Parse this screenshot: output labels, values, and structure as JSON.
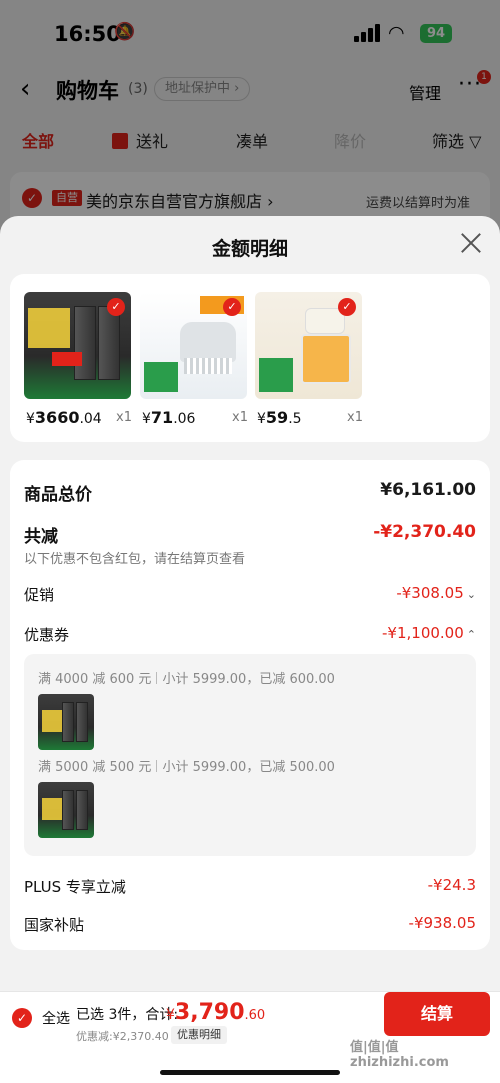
{
  "status_bar": {
    "time": "16:50",
    "battery": "94"
  },
  "nav": {
    "title": "购物车",
    "count": "(3)",
    "address_protect": "地址保护中 ›",
    "manage": "管理",
    "more": "···",
    "badge": "1"
  },
  "filters": {
    "all": "全部",
    "gift": "送礼",
    "combo": "凑单",
    "price_drop": "降价",
    "filter": "筛选"
  },
  "store": {
    "tag": "自营",
    "name": "美的京东自营官方旗舰店 ›",
    "note": "运费以结算时为准"
  },
  "sheet": {
    "title": "金额明细",
    "products": [
      {
        "price_symbol": "¥",
        "price_int": "3660",
        "price_dec": ".04",
        "qty": "x1",
        "image": "fridge"
      },
      {
        "price_symbol": "¥",
        "price_int": "71",
        "price_dec": ".06",
        "qty": "x1",
        "image": "gadget"
      },
      {
        "price_symbol": "¥",
        "price_int": "59",
        "price_dec": ".5",
        "qty": "x1",
        "image": "chopper"
      }
    ],
    "total_label": "商品总价",
    "total_value": "¥6,161.00",
    "reduce_label": "共减",
    "reduce_value": "-¥2,370.40",
    "reduce_note": "以下优惠不包含红包，请在结算页查看",
    "promo_label": "促销",
    "promo_value": "-¥308.05",
    "coupon_label": "优惠券",
    "coupon_value": "-¥1,100.00",
    "coupons": [
      {
        "rule": "满 4000 减 600 元",
        "detail": "小计 5999.00，已减 600.00"
      },
      {
        "rule": "满 5000 减 500 元",
        "detail": "小计 5999.00，已减 500.00"
      }
    ],
    "plus_label": "PLUS 专享立减",
    "plus_value": "-¥24.3",
    "subsidy_label": "国家补贴",
    "subsidy_value": "-¥938.05"
  },
  "bottom": {
    "select_all": "全选",
    "summary": "已选 3件，合计:",
    "total_symbol": "¥",
    "total_int": "3,790",
    "total_dec": ".60",
    "saved": "优惠减:¥2,370.40",
    "detail_btn": "优惠明细",
    "checkout": "结算",
    "watermark": "值|值|值 zhizhizhi.com"
  },
  "colors": {
    "accent": "#e2231a",
    "battery": "#34c759"
  }
}
